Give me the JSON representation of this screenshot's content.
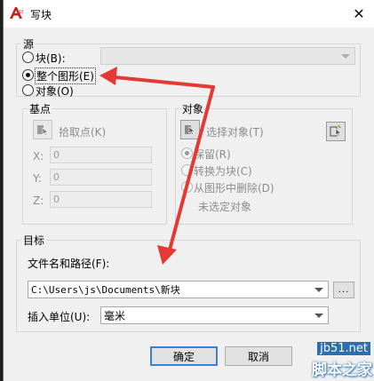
{
  "window": {
    "title": "写块"
  },
  "source": {
    "group_label": "源",
    "block_label": "块(B):",
    "entire_drawing_label": "整个图形(E)",
    "objects_label": "对象(O)",
    "selected": "entire_drawing"
  },
  "base_point": {
    "group_label": "基点",
    "pick_point_label": "拾取点(K)",
    "x_label": "X:",
    "x_value": "0",
    "y_label": "Y:",
    "y_value": "0",
    "z_label": "Z:",
    "z_value": "0"
  },
  "objects": {
    "group_label": "对象",
    "select_objects_label": "选择对象(T)",
    "retain_label": "保留(R)",
    "convert_label": "转换为块(C)",
    "delete_label": "从图形中删除(D)",
    "status_text": "未选定对象"
  },
  "destination": {
    "group_label": "目标",
    "path_label": "文件名和路径(F):",
    "path_value": "C:\\Users\\js\\Documents\\新块",
    "browse_label": "...",
    "units_label": "插入单位(U):",
    "units_value": "毫米"
  },
  "buttons": {
    "ok": "确定",
    "cancel": "取消"
  },
  "watermark": {
    "site": "jb51.net",
    "name": "脚本之家"
  },
  "colors": {
    "annotation_arrow": "#e53935",
    "default_button_border": "#3c7fd8"
  },
  "icons": {
    "close": "close-icon",
    "app": "autocad-app-icon",
    "pick": "pick-point-icon",
    "select": "select-objects-icon",
    "quick_select": "quick-select-icon"
  }
}
